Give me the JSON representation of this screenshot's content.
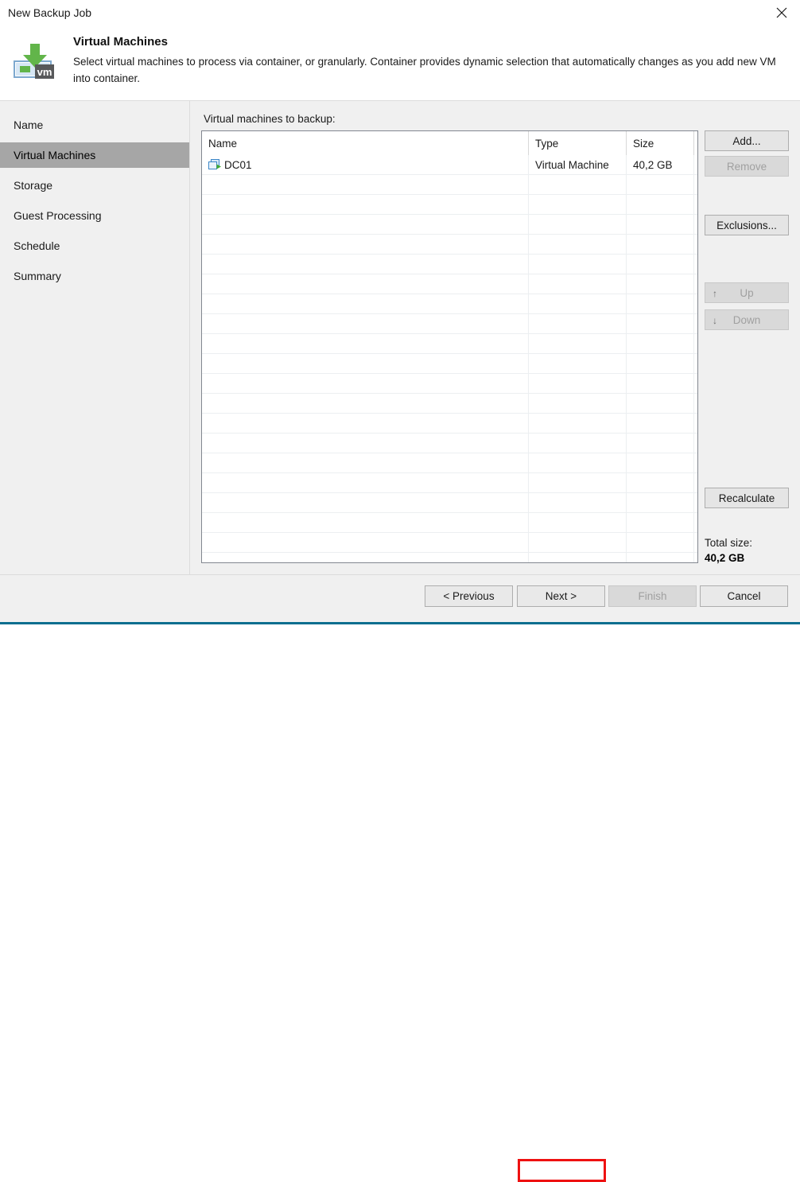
{
  "window": {
    "title": "New Backup Job",
    "close_icon": "close-icon"
  },
  "header": {
    "icon": "vm-download-icon",
    "title": "Virtual Machines",
    "description": "Select virtual machines to process via container, or granularly. Container provides dynamic selection that automatically changes as you add new VM into container."
  },
  "sidebar": {
    "items": [
      {
        "label": "Name",
        "active": false
      },
      {
        "label": "Virtual Machines",
        "active": true
      },
      {
        "label": "Storage",
        "active": false
      },
      {
        "label": "Guest Processing",
        "active": false
      },
      {
        "label": "Schedule",
        "active": false
      },
      {
        "label": "Summary",
        "active": false
      }
    ]
  },
  "main": {
    "list_label": "Virtual machines to backup:",
    "table": {
      "columns": [
        "Name",
        "Type",
        "Size"
      ],
      "rows": [
        {
          "icon": "virtual-machine-icon",
          "name": "DC01",
          "type": "Virtual Machine",
          "size": "40,2 GB"
        }
      ]
    },
    "side_buttons": [
      {
        "label": "Add...",
        "enabled": true,
        "glyph": ""
      },
      {
        "label": "Remove",
        "enabled": false,
        "glyph": ""
      },
      {
        "label": "Exclusions...",
        "enabled": true,
        "glyph": ""
      },
      {
        "label": "Up",
        "enabled": false,
        "glyph": "↑"
      },
      {
        "label": "Down",
        "enabled": false,
        "glyph": "↓"
      },
      {
        "label": "Recalculate",
        "enabled": true,
        "glyph": ""
      }
    ],
    "total_size_label": "Total size:",
    "total_size_value": "40,2 GB"
  },
  "footer": {
    "buttons": [
      {
        "label": "< Previous",
        "enabled": true,
        "highlighted": false
      },
      {
        "label": "Next >",
        "enabled": true,
        "highlighted": true
      },
      {
        "label": "Finish",
        "enabled": false,
        "highlighted": false
      },
      {
        "label": "Cancel",
        "enabled": true,
        "highlighted": false
      }
    ]
  },
  "colors": {
    "accent": "#0c6e8f",
    "nav_active": "#a6a6a6",
    "highlight": "#ee1111",
    "panel": "#f0f0f0",
    "icon_green": "#62b54a",
    "icon_blue": "#3c87c8",
    "icon_dark": "#58595b"
  }
}
